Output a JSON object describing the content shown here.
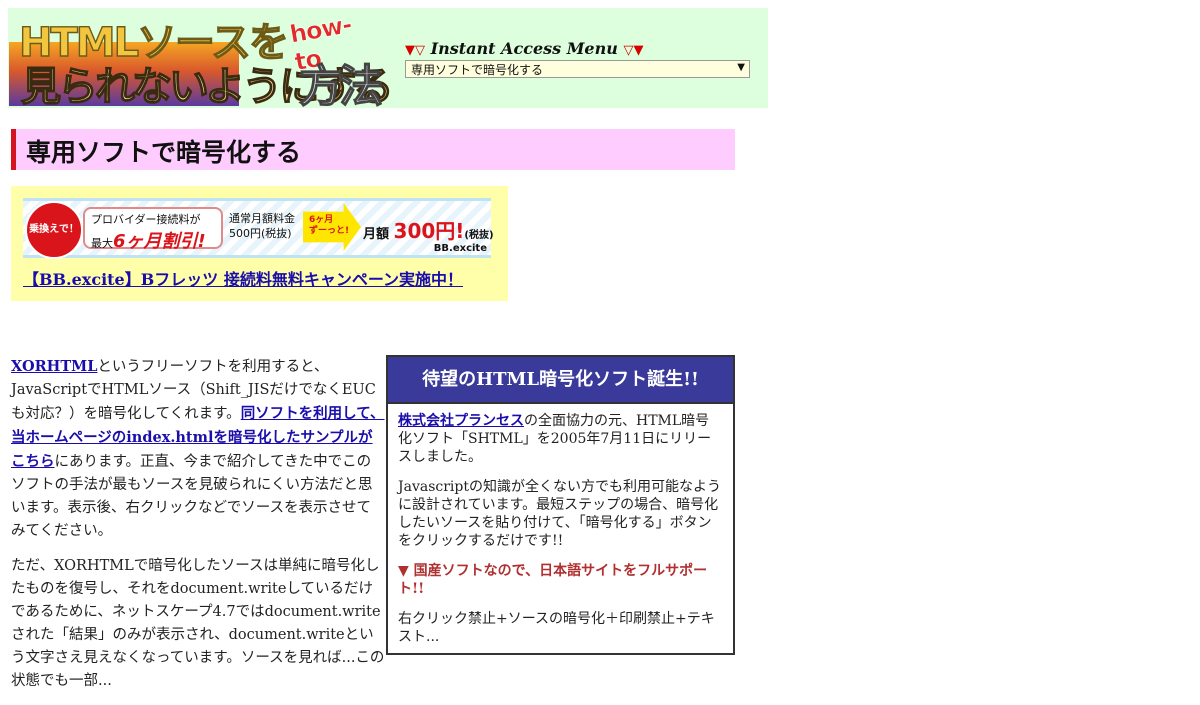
{
  "header": {
    "logo": {
      "line1": "HTMLソースを",
      "line2": "見られないようにする",
      "howto": "how-to",
      "houhou": "方法"
    },
    "menu_title_prefix": "▼▽",
    "menu_title": "Instant Access Menu",
    "menu_title_suffix": "▽▼",
    "menu_selected": "専用ソフトで暗号化する",
    "menu_arrow": "▼"
  },
  "page_title": "専用ソフトで暗号化する",
  "ad": {
    "circle_text": "乗換えで！",
    "pill_line1": "プロバイダー接続料が",
    "pill_line2_prefix": "最大",
    "pill_line2_emphasis": "6ヶ月割引!",
    "normal_price_line1": "通常月額料金",
    "normal_price_line2": "500円(税抜)",
    "arrow_line1": "6ヶ月",
    "arrow_line2": "ずーっと!",
    "monthly_prefix": "月額",
    "monthly_price": "300円!",
    "monthly_tax": "(税抜)",
    "brand": "BB.excite",
    "link_text": "【BB.excite】Bフレッツ 接続料無料キャンペーン実施中！"
  },
  "main": {
    "p1": {
      "link1": "XORHTML",
      "text1": "というフリーソフトを利用すると、JavaScriptでHTMLソース（Shift_JISだけでなくEUCも対応？）を暗号化してくれます。",
      "link2": "同ソフトを利用して、当ホームページのindex.htmlを暗号化したサンプルがこちら",
      "text2": "にあります。正直、今まで紹介してきた中でこのソフトの手法が最もソースを見破られにくい方法だと思います。表示後、右クリックなどでソースを表示させてみてください。"
    },
    "p2": "ただ、XORHTMLで暗号化したソースは単純に暗号化したものを復号し、それをdocument.writeしているだけであるために、ネットスケープ4.7ではdocument.writeされた「結果」のみが表示され、document.writeという文字さえ見えなくなっています。ソースを見れば...この状態でも一部..."
  },
  "sidebox": {
    "heading": "待望のHTML暗号化ソフト誕生!!",
    "p1_link": "株式会社プランセス",
    "p1_text": "の全面協力の元、HTML暗号化ソフト「SHTML」を2005年7月11日にリリースしました。",
    "p2": "Javascriptの知識が全くない方でも利用可能なように設計されています。最短ステップの場合、暗号化したいソースを貼り付けて、「暗号化する」ボタンをクリックするだけです!!",
    "sub_heading": "▼ 国産ソフトなので、日本語サイトをフルサポート!!",
    "p3": "右クリック禁止+ソースの暗号化＋印刷禁止+テキスト..."
  }
}
